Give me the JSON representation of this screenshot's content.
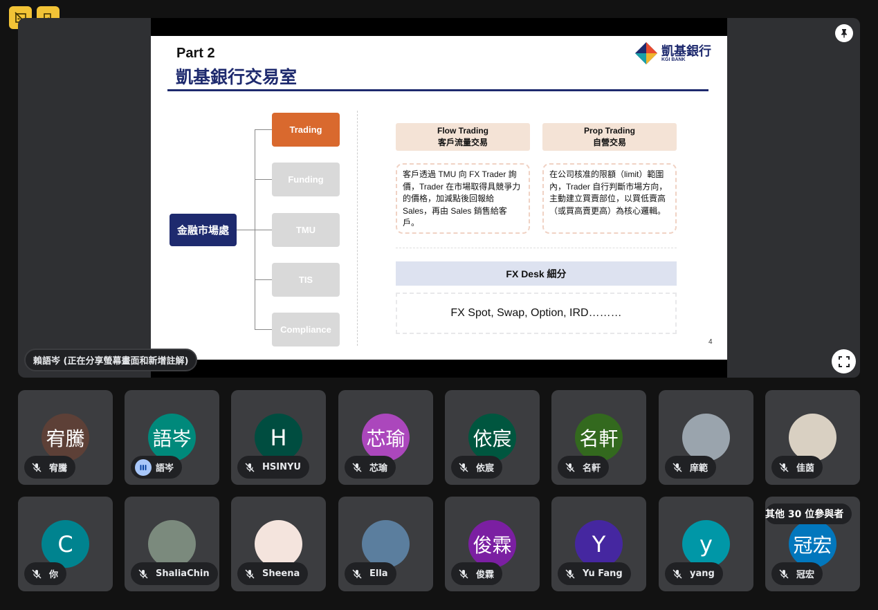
{
  "toolbar": {
    "captions_icon": "captions-off-icon",
    "leave_icon": "door-icon"
  },
  "presentation": {
    "presenter_label": "賴語岑 (正在分享螢幕畫面和新增註解)",
    "slide": {
      "part": "Part 2",
      "title": "凱基銀行交易室",
      "logo_text": "凱基銀行",
      "logo_sub": "KGI BANK",
      "root": "金融市場處",
      "branches": [
        {
          "label": "Trading",
          "active": true
        },
        {
          "label": "Funding",
          "active": false
        },
        {
          "label": "TMU",
          "active": false
        },
        {
          "label": "TIS",
          "active": false
        },
        {
          "label": "Compliance",
          "active": false
        }
      ],
      "col1_head_en": "Flow Trading",
      "col1_head_zh": "客戶流量交易",
      "col2_head_en": "Prop Trading",
      "col2_head_zh": "自營交易",
      "col1_desc": "客戶透過 TMU 向 FX Trader 詢價，Trader 在市場取得具競爭力的價格，加減點後回報給 Sales，再由 Sales 銷售給客戶。",
      "col2_desc": "在公司核准的限額（limit）範圍內，Trader 自行判斷市場方向，主動建立買賣部位，以買低賣高（或買高賣更高）為核心邏輯。",
      "fx_head": "FX Desk 細分",
      "fx_body": "FX Spot, Swap, Option, IRD………",
      "page_no": "4"
    }
  },
  "colors": {
    "accent": "#f2c336",
    "navy": "#1e2a6e",
    "trading_orange": "#d9692e",
    "inactive_gray": "#d9d9d9"
  },
  "participants_row1": [
    {
      "avatar": "宥騰",
      "name": "宥騰",
      "bg": "#5d4037",
      "speaking": false
    },
    {
      "avatar": "語岑",
      "name": "語岑",
      "bg": "#00897b",
      "speaking": true
    },
    {
      "avatar": "H",
      "name": "HSINYU",
      "bg": "#004d40",
      "speaking": false
    },
    {
      "avatar": "芯瑜",
      "name": "芯瑜",
      "bg": "#ab47bc",
      "speaking": false
    },
    {
      "avatar": "依宸",
      "name": "依宸",
      "bg": "#00563f",
      "speaking": false
    },
    {
      "avatar": "名軒",
      "name": "名軒",
      "bg": "#33691e",
      "speaking": false
    },
    {
      "avatar": "",
      "name": "庠範",
      "bg": "#9aa4ad",
      "speaking": false
    },
    {
      "avatar": "",
      "name": "佳茵",
      "bg": "#d9d0c2",
      "speaking": false
    }
  ],
  "participants_row2": [
    {
      "avatar": "C",
      "name": "你",
      "bg": "#00838f",
      "speaking": false
    },
    {
      "avatar": "",
      "name": "ShaliaChin",
      "bg": "#7b8a7d",
      "speaking": false
    },
    {
      "avatar": "",
      "name": "Sheena",
      "bg": "#f4e4dd",
      "speaking": false
    },
    {
      "avatar": "",
      "name": "Ella",
      "bg": "#5b7e9e",
      "speaking": false
    },
    {
      "avatar": "俊霖",
      "name": "俊霖",
      "bg": "#7b1fa2",
      "speaking": false
    },
    {
      "avatar": "Y",
      "name": "Yu Fang",
      "bg": "#4527a0",
      "speaking": false
    },
    {
      "avatar": "y",
      "name": "yang",
      "bg": "#0097a7",
      "speaking": false
    },
    {
      "avatar": "冠宏",
      "name": "冠宏",
      "bg": "#0277bd",
      "speaking": false
    }
  ],
  "others_label": "其他 30 位參與者"
}
